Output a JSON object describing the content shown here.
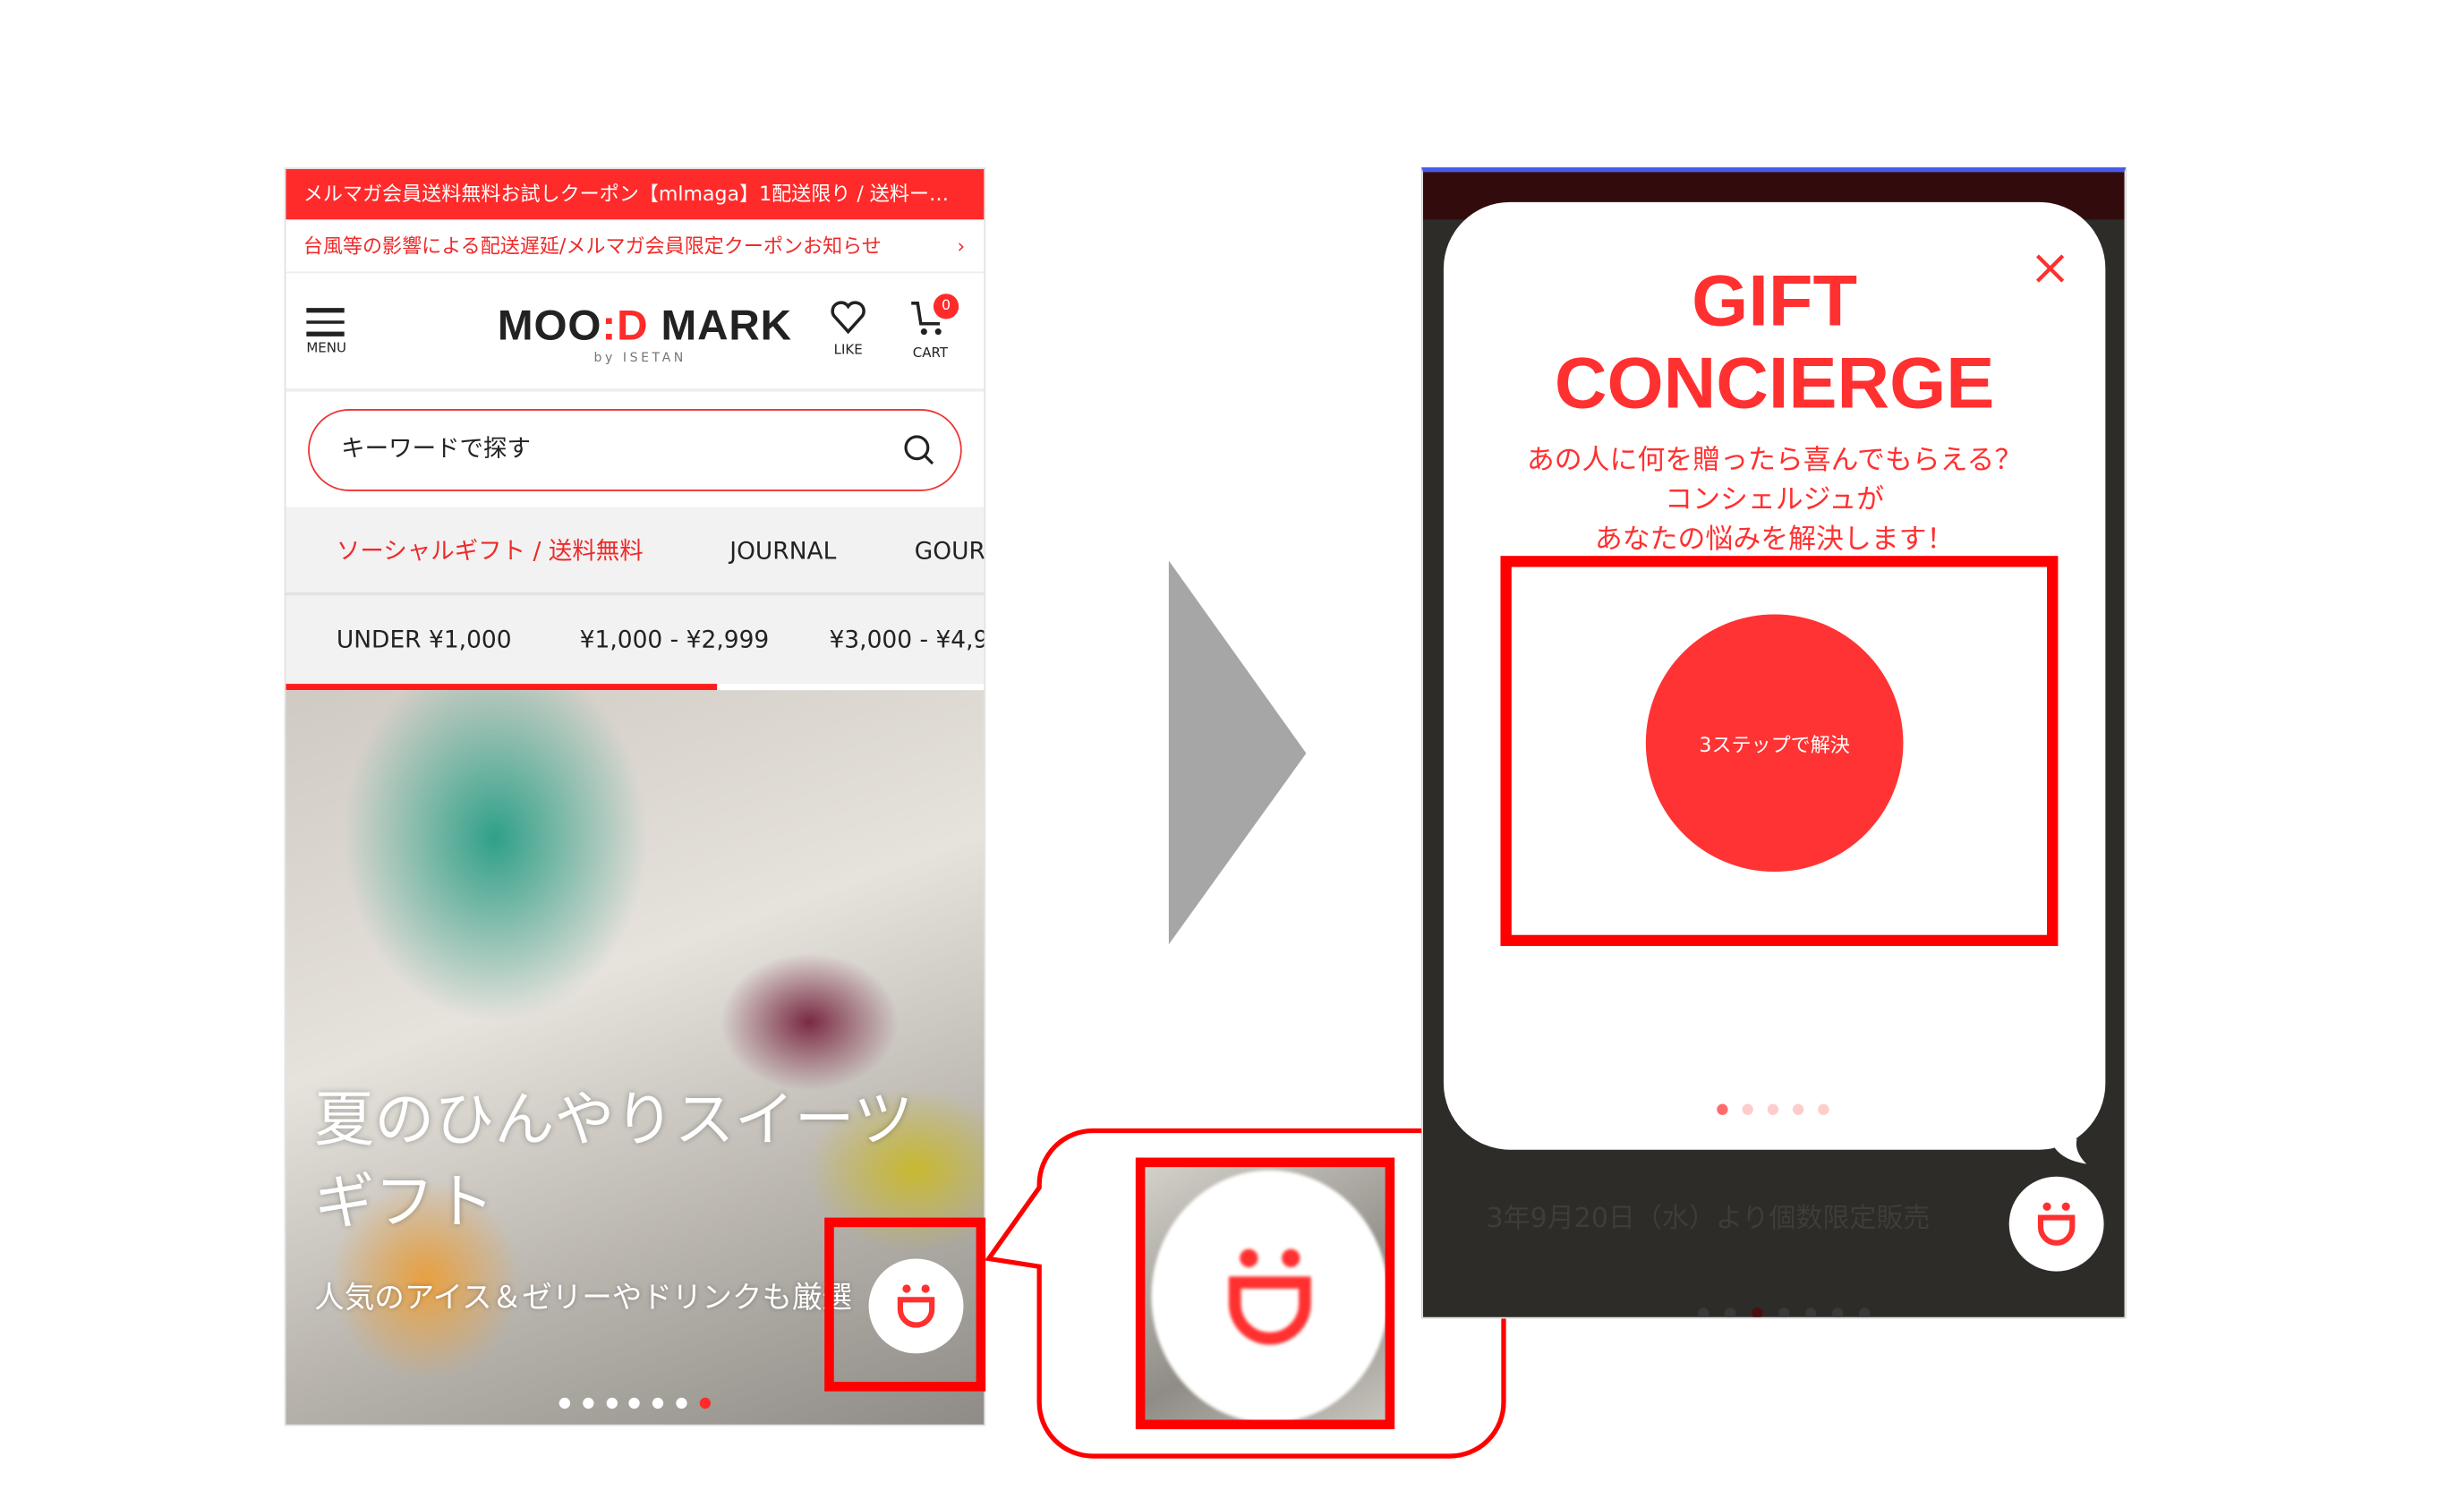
{
  "left_screen": {
    "promo_banner": "メルマガ会員送料無料お試しクーポン【mlmaga】1配送限り / 送料ー…",
    "notice": "台風等の影響による配送遅延/メルマガ会員限定クーポンお知らせ",
    "notice_chevron": "›",
    "menu_label": "MENU",
    "logo_left": "MOO",
    "logo_accent": ":D",
    "logo_right": " MARK",
    "logo_sub": "by ISETAN",
    "like_label": "LIKE",
    "cart_label": "CART",
    "cart_count": "0",
    "search_placeholder": "キーワードで探す",
    "category_tabs": [
      {
        "label": "ソーシャルギフト / 送料無料",
        "active": true
      },
      {
        "label": "JOURNAL"
      },
      {
        "label": "GOUR"
      }
    ],
    "price_tabs": [
      "UNDER ¥1,000",
      "¥1,000 - ¥2,999",
      "¥3,000 - ¥4,9"
    ],
    "hero_title_1": "夏のひんやりスイーツ",
    "hero_title_2": "ギフト",
    "hero_subtitle": "人気のアイス＆ゼリーやドリンクも厳選",
    "hero_slides": 7,
    "hero_active_slide": 7
  },
  "right_screen": {
    "title_1": "GIFT",
    "title_2": "CONCIERGE",
    "message_1": "あの人に何を贈ったら喜んでもらえる？",
    "message_2": "コンシェルジュが",
    "message_3": "あなたの悩みを解決します！",
    "cta_label": "3ステップで解決",
    "close_icon": "×",
    "modal_slides": 5,
    "modal_active_slide": 1,
    "background_text": "3年9月20日（水）より個数限定販売"
  },
  "colors": {
    "brand_red": "#ff3030",
    "highlight_red": "#ff0000",
    "arrow_grey": "#a6a6a6"
  }
}
